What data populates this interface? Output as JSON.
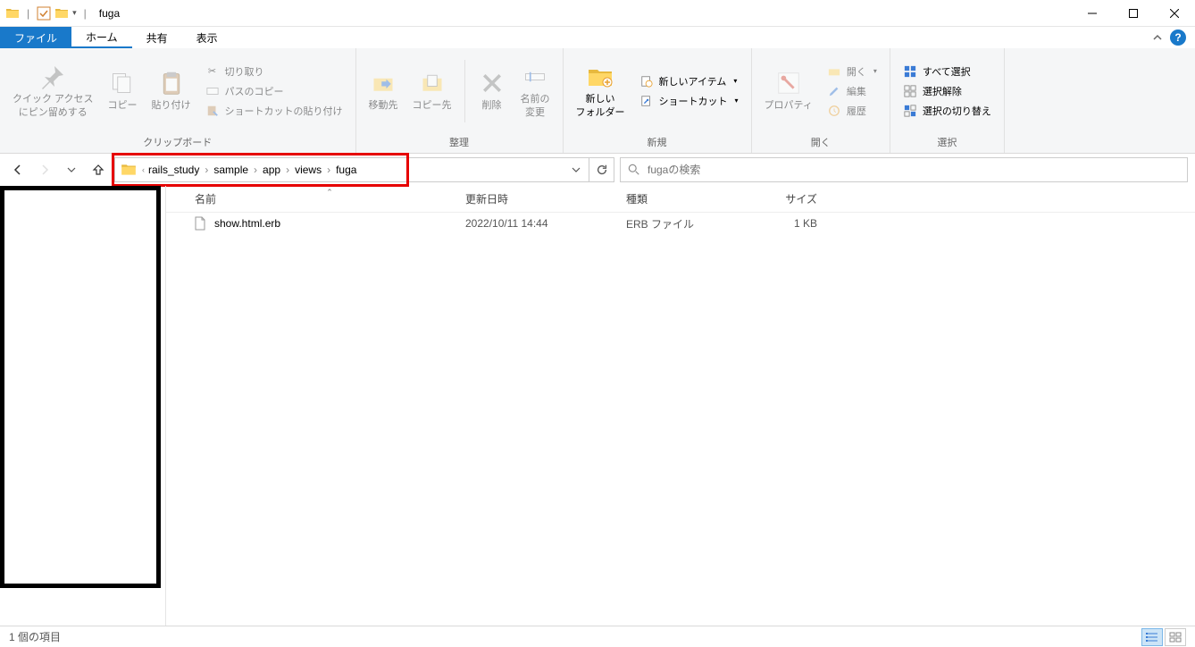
{
  "window": {
    "title": "fuga"
  },
  "menu": {
    "file": "ファイル",
    "home": "ホーム",
    "share": "共有",
    "view": "表示"
  },
  "ribbon": {
    "clipboard": {
      "label": "クリップボード",
      "pin": "クイック アクセス\nにピン留めする",
      "copy": "コピー",
      "paste": "貼り付け",
      "cut": "切り取り",
      "copy_path": "パスのコピー",
      "paste_shortcut": "ショートカットの貼り付け"
    },
    "organize": {
      "label": "整理",
      "move_to": "移動先",
      "copy_to": "コピー先",
      "delete": "削除",
      "rename": "名前の\n変更"
    },
    "new": {
      "label": "新規",
      "new_folder": "新しい\nフォルダー",
      "new_item": "新しいアイテム",
      "shortcut": "ショートカット"
    },
    "open": {
      "label": "開く",
      "properties": "プロパティ",
      "open": "開く",
      "edit": "編集",
      "history": "履歴"
    },
    "select": {
      "label": "選択",
      "select_all": "すべて選択",
      "select_none": "選択解除",
      "invert": "選択の切り替え"
    }
  },
  "breadcrumb": [
    "rails_study",
    "sample",
    "app",
    "views",
    "fuga"
  ],
  "search": {
    "placeholder": "fugaの検索"
  },
  "columns": {
    "name": "名前",
    "date": "更新日時",
    "type": "種類",
    "size": "サイズ"
  },
  "files": [
    {
      "name": "show.html.erb",
      "date": "2022/10/11 14:44",
      "type": "ERB ファイル",
      "size": "1 KB"
    }
  ],
  "status": {
    "count": "1 個の項目"
  }
}
